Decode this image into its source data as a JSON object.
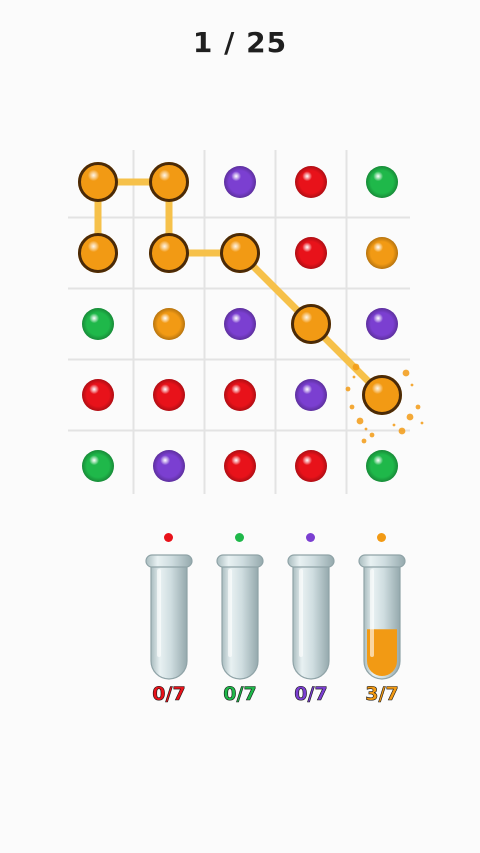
{
  "header": {
    "level_text": "1 / 25"
  },
  "colors": {
    "red": "#e8121a",
    "green": "#1fb84a",
    "purple": "#7b3fd1",
    "orange": "#f29a14",
    "line": "#f6c14a",
    "ring": "#4a2a08"
  },
  "board": {
    "rows": [
      [
        "orange",
        "orange",
        "purple",
        "red",
        "green"
      ],
      [
        "orange",
        "orange",
        "orange",
        "red",
        "orange"
      ],
      [
        "green",
        "orange",
        "purple",
        "orange",
        "purple"
      ],
      [
        "red",
        "red",
        "red",
        "purple",
        "orange"
      ],
      [
        "green",
        "purple",
        "red",
        "red",
        "green"
      ]
    ],
    "path": [
      [
        1,
        0
      ],
      [
        0,
        0
      ],
      [
        0,
        1
      ],
      [
        1,
        1
      ],
      [
        1,
        2
      ],
      [
        2,
        3
      ],
      [
        3,
        4
      ]
    ]
  },
  "tubes": [
    {
      "color": "red",
      "count_label": "0/7",
      "filled": 0,
      "capacity": 7
    },
    {
      "color": "green",
      "count_label": "0/7",
      "filled": 0,
      "capacity": 7
    },
    {
      "color": "purple",
      "count_label": "0/7",
      "filled": 0,
      "capacity": 7
    },
    {
      "color": "orange",
      "count_label": "3/7",
      "filled": 3,
      "capacity": 7
    }
  ]
}
